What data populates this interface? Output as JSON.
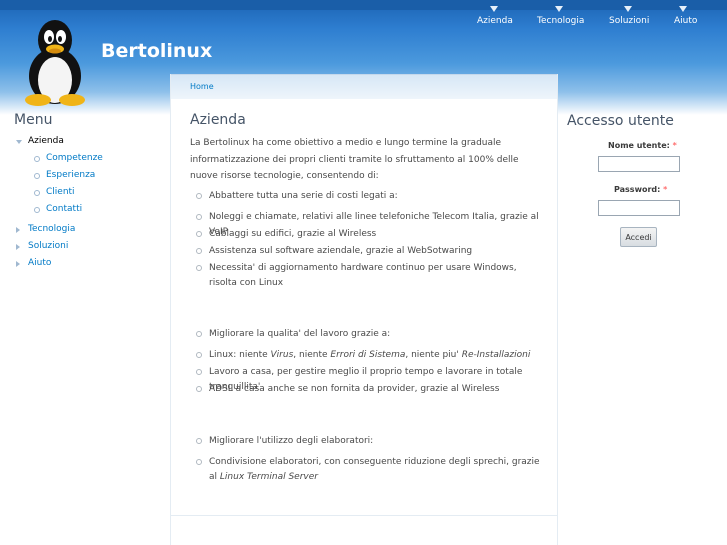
{
  "site": {
    "name": "Bertolinux"
  },
  "primary_links": [
    "Azienda",
    "Tecnologia",
    "Soluzioni",
    "Aiuto"
  ],
  "menu": {
    "title": "Menu",
    "items": [
      {
        "label": "Azienda",
        "state": "expanded",
        "active": true,
        "children": [
          "Competenze",
          "Esperienza",
          "Clienti",
          "Contatti"
        ]
      },
      {
        "label": "Tecnologia",
        "state": "collapsed"
      },
      {
        "label": "Soluzioni",
        "state": "collapsed"
      },
      {
        "label": "Aiuto",
        "state": "collapsed"
      }
    ]
  },
  "breadcrumb": {
    "home": "Home"
  },
  "content": {
    "title": "Azienda",
    "intro": "La Bertolinux ha come obiettivo a medio e lungo termine la graduale informatizzazione dei propri clienti tramite lo sfruttamento al 100% delle nuove risorse tecnologie, consentendo di:",
    "group1": {
      "heading": "Abbattere tutta una serie di costi legati a:",
      "items": [
        "Noleggi e chiamate, relativi alle linee telefoniche Telecom Italia, grazie al VoIP",
        "Cablaggi su edifici, grazie al Wireless",
        "Assistenza sul software aziendale, grazie al WebSotwaring",
        "Necessita' di aggiornamento hardware continuo per usare Windows, risolta con Linux"
      ]
    },
    "group2": {
      "heading": "Migliorare la qualita' del lavoro grazie a:",
      "item1": {
        "t1": "Linux: niente ",
        "i1": "Virus",
        "t2": ", niente ",
        "i2": "Errori di Sistema",
        "t3": ", niente piu' ",
        "i3": "Re-Installazioni"
      },
      "items": [
        "Lavoro a casa, per gestire meglio il proprio tempo e lavorare in totale tranquillita'",
        "ADSL a casa anche se non fornita da provider, grazie al Wireless"
      ]
    },
    "group3": {
      "heading": "Migliorare l'utilizzo degli elaboratori:",
      "item1": {
        "text": "Condivisione elaboratori, con conseguente riduzione degli sprechi, grazie al",
        "italic": "Linux Terminal Server"
      }
    }
  },
  "login": {
    "title": "Accesso utente",
    "username_label": "Nome utente:",
    "password_label": "Password:",
    "required_mark": "*",
    "submit_label": "Accedi"
  }
}
